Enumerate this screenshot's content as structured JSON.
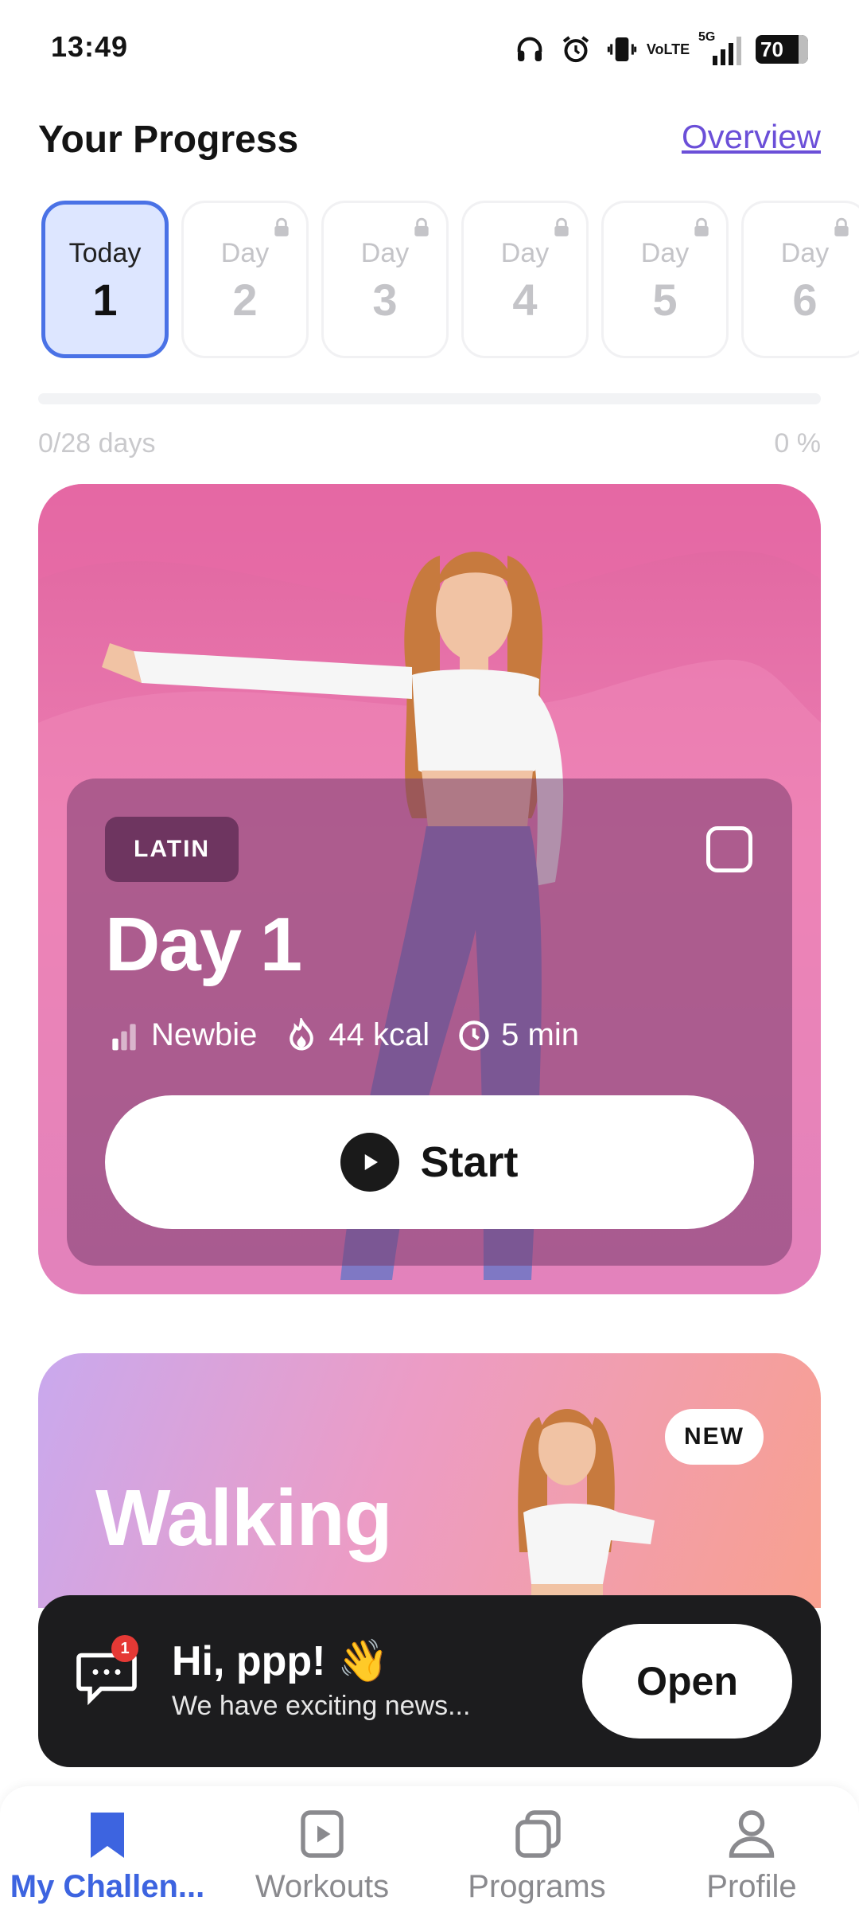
{
  "status_bar": {
    "time": "13:49",
    "volte_line1": "Vo",
    "volte_line2": "LTE",
    "network": "5G",
    "battery": "70",
    "icons": [
      "headphones-icon",
      "alarm-icon",
      "vibrate-icon",
      "volte-icon",
      "signal-icon",
      "battery-icon"
    ]
  },
  "header": {
    "title": "Your Progress",
    "overview_link": "Overview"
  },
  "days": [
    {
      "label": "Today",
      "number": "1",
      "active": true,
      "locked": false
    },
    {
      "label": "Day",
      "number": "2",
      "active": false,
      "locked": true
    },
    {
      "label": "Day",
      "number": "3",
      "active": false,
      "locked": true
    },
    {
      "label": "Day",
      "number": "4",
      "active": false,
      "locked": true
    },
    {
      "label": "Day",
      "number": "5",
      "active": false,
      "locked": true
    },
    {
      "label": "Day",
      "number": "6",
      "active": false,
      "locked": true
    }
  ],
  "progress": {
    "days_text": "0/28 days",
    "percent_text": "0 %",
    "fraction": 0
  },
  "challenge_card": {
    "tag": "LATIN",
    "title": "Day 1",
    "level": "Newbie",
    "calories": "44 kcal",
    "duration": "5 min",
    "start_label": "Start"
  },
  "walking_card": {
    "title": "Walking",
    "badge": "NEW"
  },
  "notification": {
    "badge_count": "1",
    "title": "Hi, ppp! 👋",
    "subtitle": "We have exciting news...",
    "open_label": "Open"
  },
  "bottom_nav": {
    "items": [
      {
        "label": "My Challen...",
        "icon": "bookmark-icon",
        "active": true
      },
      {
        "label": "Workouts",
        "icon": "play-square-icon",
        "active": false
      },
      {
        "label": "Programs",
        "icon": "stacked-squares-icon",
        "active": false
      },
      {
        "label": "Profile",
        "icon": "person-icon",
        "active": false
      }
    ]
  },
  "colors": {
    "accent": "#4a72e6",
    "link": "#6b4fd8",
    "card_pink": "#e0649f",
    "notification_bg": "#1c1c1e"
  }
}
